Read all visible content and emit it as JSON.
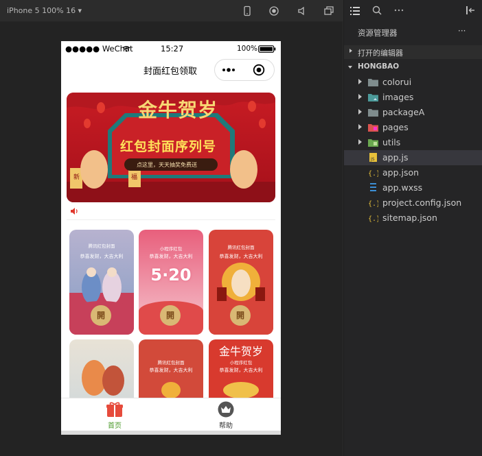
{
  "toolbar": {
    "device": "iPhone 5 100% 16 ▾"
  },
  "phone": {
    "status": {
      "signal": "●●●●● WeChat",
      "time": "15:27",
      "battery": "100%"
    },
    "nav_title": "封面红包领取",
    "banner": {
      "headline": "金牛贺岁",
      "subline": "红包封面序列号",
      "tagline": "点这里，天天抽奖免费送",
      "left_scroll": "新",
      "right_scroll": "福"
    },
    "cards": [
      {
        "caption": "腾讯红包封面",
        "wish": "恭喜发财，大吉大利",
        "btn": "開",
        "bg": "#c7405a"
      },
      {
        "caption": "小程序红包",
        "wish": "恭喜发财，大吉大利",
        "btn": "開",
        "bg": "#e2687e",
        "badge": "5·20"
      },
      {
        "caption": "腾讯红包封面",
        "wish": "恭喜发财，大吉大利",
        "btn": "開",
        "bg": "#d8443a"
      },
      {
        "caption": "",
        "wish": "",
        "btn": "",
        "bg": "#d6c4b0"
      },
      {
        "caption": "腾讯红包封面",
        "wish": "恭喜发财，大吉大利",
        "btn": "",
        "bg": "#d24a3a"
      },
      {
        "caption": "小程序红包",
        "wish": "恭喜发财，大吉大利",
        "btn": "",
        "bg": "#d83a2e",
        "headline": "金牛贺岁"
      }
    ],
    "tabs": [
      {
        "label": "首页",
        "active": true
      },
      {
        "label": "帮助",
        "active": false
      }
    ]
  },
  "sidebar": {
    "title": "资源管理器",
    "more": "···",
    "sections": [
      {
        "label": "打开的编辑器"
      },
      {
        "label": "HONGBAO"
      }
    ],
    "items": [
      {
        "label": "colorui",
        "kind": "folder",
        "color": "#7f8c8d"
      },
      {
        "label": "images",
        "kind": "folder",
        "color": "#4c9a9a"
      },
      {
        "label": "packageA",
        "kind": "folder",
        "color": "#7f8c8d"
      },
      {
        "label": "pages",
        "kind": "folder",
        "color": "#d9534f"
      },
      {
        "label": "utils",
        "kind": "folder",
        "color": "#6aa84f"
      },
      {
        "label": "app.js",
        "kind": "js",
        "color": "#e8c13a"
      },
      {
        "label": "app.json",
        "kind": "json",
        "color": "#e8c13a"
      },
      {
        "label": "app.wxss",
        "kind": "css",
        "color": "#3c8fd6"
      },
      {
        "label": "project.config.json",
        "kind": "json",
        "color": "#e8c13a"
      },
      {
        "label": "sitemap.json",
        "kind": "json",
        "color": "#e8c13a"
      }
    ]
  }
}
